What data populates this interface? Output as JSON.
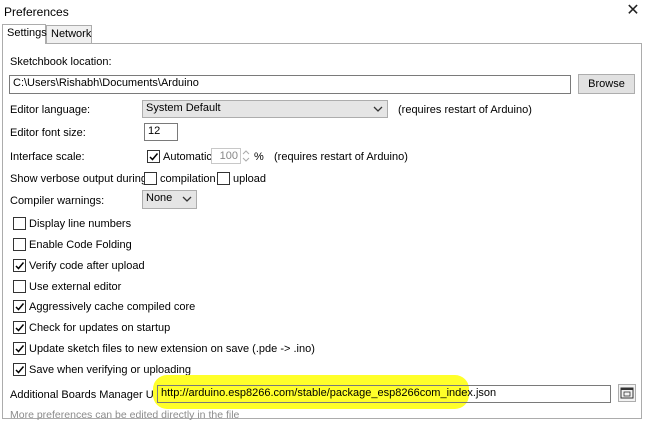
{
  "window": {
    "title": "Preferences"
  },
  "tabs": [
    {
      "label": "Settings"
    },
    {
      "label": "Network"
    }
  ],
  "sketchbook": {
    "label": "Sketchbook location:",
    "value": "C:\\Users\\Rishabh\\Documents\\Arduino",
    "browse_label": "Browse"
  },
  "editor_language": {
    "label": "Editor language:",
    "value": "System Default",
    "note": "(requires restart of Arduino)"
  },
  "font_size": {
    "label": "Editor font size:",
    "value": "12"
  },
  "interface_scale": {
    "label": "Interface scale:",
    "automatic_label": "Automatic",
    "automatic_checked": true,
    "value": "100",
    "unit": "%",
    "note": "(requires restart of Arduino)"
  },
  "verbose": {
    "label": "Show verbose output during:",
    "compilation_label": "compilation",
    "upload_label": "upload",
    "compilation_checked": false,
    "upload_checked": false
  },
  "compiler_warnings": {
    "label": "Compiler warnings:",
    "value": "None"
  },
  "options": [
    {
      "label": "Display line numbers",
      "checked": false
    },
    {
      "label": "Enable Code Folding",
      "checked": false
    },
    {
      "label": "Verify code after upload",
      "checked": true
    },
    {
      "label": "Use external editor",
      "checked": false
    },
    {
      "label": "Aggressively cache compiled core",
      "checked": true
    },
    {
      "label": "Check for updates on startup",
      "checked": true
    },
    {
      "label": "Update sketch files to new extension on save (.pde -> .ino)",
      "checked": true
    },
    {
      "label": "Save when verifying or uploading",
      "checked": true
    }
  ],
  "boards_manager": {
    "label": "Additional Boards Manager URLs:",
    "value": "http://arduino.esp8266.com/stable/package_esp8266com_index.json"
  },
  "footer": {
    "more_text": "More preferences can be edited directly in the file"
  },
  "colors": {
    "highlight": "#ffff2a",
    "panel_border": "#acacac"
  },
  "icons": {
    "close": "close-icon",
    "dropdown": "chevron-down-icon",
    "window": "open-window-icon"
  }
}
